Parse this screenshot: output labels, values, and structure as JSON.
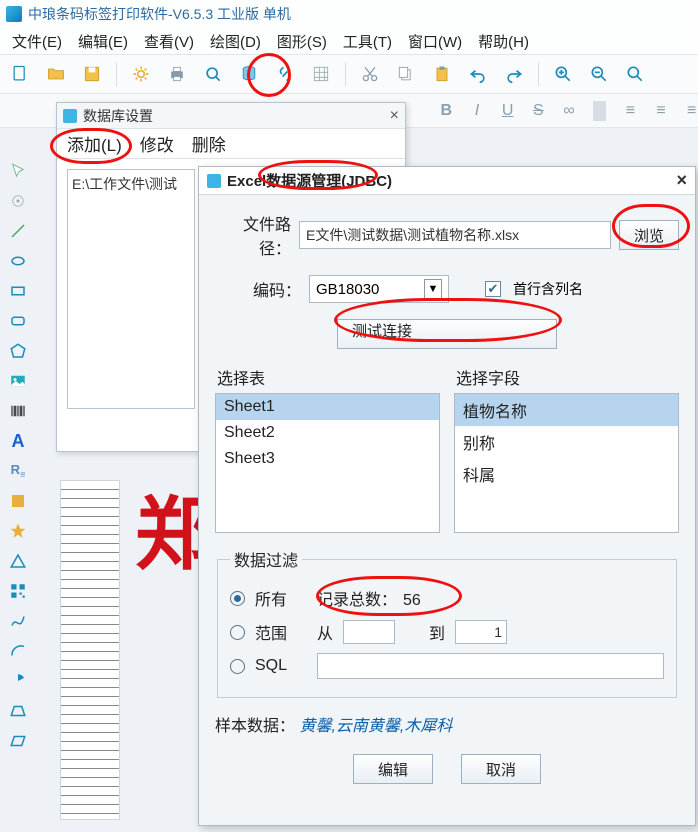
{
  "app": {
    "title": "中琅条码标签打印软件-V6.5.3 工业版 单机"
  },
  "menu": {
    "file": "文件(E)",
    "edit": "编辑(E)",
    "view": "查看(V)",
    "draw": "绘图(D)",
    "graph": "图形(S)",
    "tool": "工具(T)",
    "window": "窗口(W)",
    "help": "帮助(H)"
  },
  "fmt": {
    "b": "B",
    "i": "I",
    "u": "U",
    "s": "S"
  },
  "dlg1": {
    "title": "数据库设置",
    "tab_add": "添加(L)",
    "tab_modify": "修改",
    "tab_delete": "删除",
    "path_display": "E:\\工作文件\\测试"
  },
  "dlg2": {
    "title": "Excel数据源管理(JDBC)",
    "lbl_path": "文件路径：",
    "path_value": "E文件\\测试数据\\测试植物名称.xlsx",
    "btn_browse": "浏览",
    "lbl_encoding": "编码：",
    "encoding_value": "GB18030",
    "chk_header": "首行含列名",
    "btn_test": "测试连接",
    "lbl_select_table": "选择表",
    "lbl_select_field": "选择字段",
    "tables": [
      "Sheet1",
      "Sheet2",
      "Sheet3"
    ],
    "fields": [
      "植物名称",
      "别称",
      "科属"
    ],
    "filter_legend": "数据过滤",
    "radio_all": "所有",
    "radio_range": "范围",
    "radio_sql": "SQL",
    "lbl_record_count": "记录总数：",
    "record_count": "56",
    "lbl_from": "从",
    "lbl_to": "到",
    "range_to": "1",
    "lbl_sample": "样本数据：",
    "sample_value": "黄馨,云南黄馨,木犀科",
    "btn_edit": "编辑",
    "btn_cancel": "取消"
  },
  "watermark": "郑"
}
